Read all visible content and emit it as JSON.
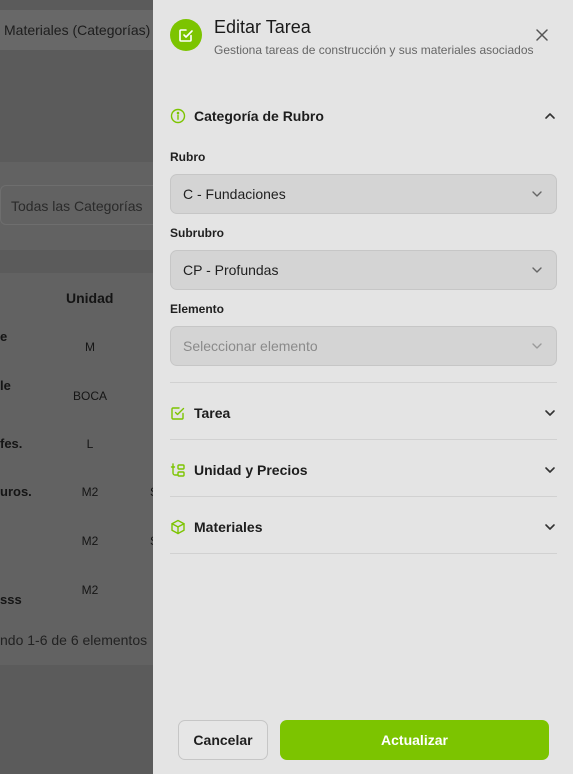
{
  "background": {
    "tab_label": "Materiales (Categorías)",
    "filter_select": "Todas las Categorías",
    "table_header_unit": "Unidad",
    "rows": [
      {
        "left": "e",
        "unit": "M",
        "edge": ""
      },
      {
        "left": "le",
        "unit": "BOCA",
        "edge": ""
      },
      {
        "left": "fes.",
        "unit": "L",
        "edge": ""
      },
      {
        "left": "uros.",
        "unit": "M2",
        "edge": "S"
      },
      {
        "left": "",
        "unit": "M2",
        "edge": "S"
      },
      {
        "left": "sss",
        "unit": "M2",
        "edge": ""
      }
    ],
    "footer": "ndo 1-6 de 6 elementos"
  },
  "drawer": {
    "title": "Editar Tarea",
    "subtitle": "Gestiona tareas de construcción y sus materiales asociados",
    "sections": {
      "categoria": "Categoría de Rubro",
      "tarea": "Tarea",
      "unidad": "Unidad y Precios",
      "materiales": "Materiales"
    },
    "fields": {
      "rubro_label": "Rubro",
      "rubro_value": "C - Fundaciones",
      "subrubro_label": "Subrubro",
      "subrubro_value": "CP - Profundas",
      "elemento_label": "Elemento",
      "elemento_placeholder": "Seleccionar elemento"
    },
    "buttons": {
      "cancel": "Cancelar",
      "submit": "Actualizar"
    }
  },
  "colors": {
    "accent": "#7cc400",
    "drawer_bg": "#e4e4e4",
    "overlay": "#5b5b5b"
  }
}
